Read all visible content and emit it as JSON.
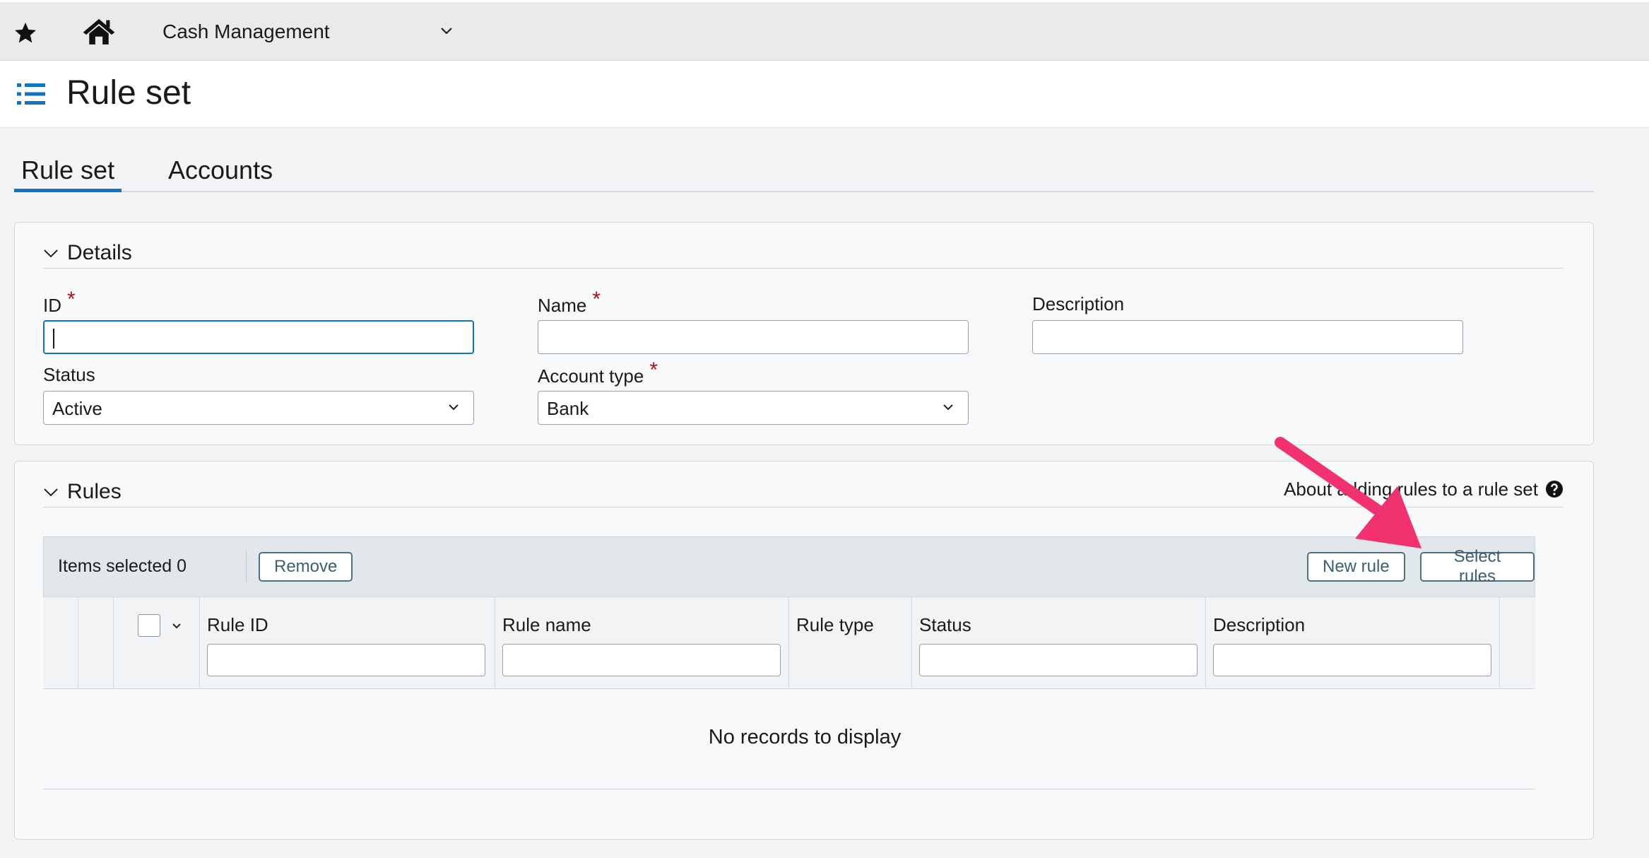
{
  "topbar": {
    "star_icon": "star-icon",
    "home_icon": "home-icon",
    "module": "Cash Management"
  },
  "header": {
    "title": "Rule set",
    "menu_icon": "list-icon"
  },
  "tabs": [
    {
      "label": "Rule set",
      "active": true
    },
    {
      "label": "Accounts",
      "active": false
    }
  ],
  "details": {
    "title": "Details",
    "fields": {
      "id": {
        "label": "ID",
        "value": "",
        "required": true
      },
      "name": {
        "label": "Name",
        "value": "",
        "required": true
      },
      "description": {
        "label": "Description",
        "value": ""
      },
      "status": {
        "label": "Status",
        "value": "Active"
      },
      "account_type": {
        "label": "Account type",
        "value": "Bank",
        "required": true
      }
    },
    "required_marker": "*"
  },
  "rules": {
    "title": "Rules",
    "about_link": "About adding rules to a rule set",
    "items_selected": "Items selected 0",
    "buttons": {
      "remove": "Remove",
      "new_rule": "New rule",
      "select_rules": "Select rules"
    },
    "columns": [
      "Rule ID",
      "Rule name",
      "Rule type",
      "Status",
      "Description"
    ],
    "empty_message": "No records to display"
  },
  "colors": {
    "accent": "#0e74c4",
    "required": "#b0131a",
    "annotation_arrow": "#f2316f"
  }
}
